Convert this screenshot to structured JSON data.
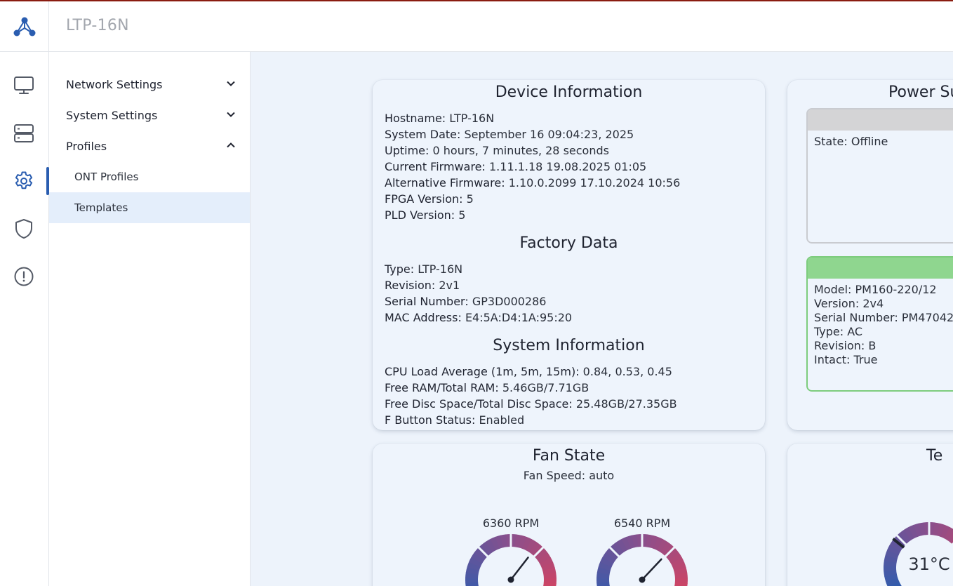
{
  "app": {
    "title": "LTP-16N",
    "logo_icon": "network-logo-icon",
    "accent": "#2a5db0"
  },
  "rail": [
    {
      "icon": "monitor-icon"
    },
    {
      "icon": "server-icon"
    },
    {
      "icon": "gear-icon",
      "active": true
    },
    {
      "icon": "shield-icon"
    },
    {
      "icon": "alert-circle-icon"
    }
  ],
  "sidebar": {
    "groups": [
      {
        "label": "Network Settings",
        "expanded": false
      },
      {
        "label": "System Settings",
        "expanded": false
      },
      {
        "label": "Profiles",
        "expanded": true,
        "items": [
          {
            "label": "ONT Profiles"
          },
          {
            "label": "Templates",
            "active": true
          }
        ]
      }
    ]
  },
  "device_info": {
    "title": "Device Information",
    "rows": [
      {
        "key": "Hostname:",
        "value": "LTP-16N"
      },
      {
        "key": "System Date:",
        "value": "September 16 09:04:23, 2025"
      },
      {
        "key": "Uptime:",
        "value": "0 hours, 7 minutes, 28 seconds"
      },
      {
        "key": "Current Firmware:",
        "value": "1.11.1.18 19.08.2025 01:05"
      },
      {
        "key": "Alternative Firmware:",
        "value": "1.10.0.2099 17.10.2024 10:56"
      },
      {
        "key": "FPGA Version:",
        "value": "5"
      },
      {
        "key": "PLD Version:",
        "value": "5"
      }
    ],
    "factory_title": "Factory Data",
    "factory_rows": [
      {
        "key": "Type:",
        "value": "LTP-16N"
      },
      {
        "key": "Revision:",
        "value": "2v1"
      },
      {
        "key": "Serial Number:",
        "value": "GP3D000286"
      },
      {
        "key": "MAC Address:",
        "value": "E4:5A:D4:1A:95:20"
      }
    ],
    "system_title": "System Information",
    "system_rows": [
      {
        "key": "CPU Load Average (1m, 5m, 15m):",
        "value": "0.84, 0.53, 0.45"
      },
      {
        "key": "Free RAM/Total RAM:",
        "value": "5.46GB/7.71GB"
      },
      {
        "key": "Free Disc Space/Total Disc Space:",
        "value": "25.48GB/27.35GB"
      },
      {
        "key": "F Button Status:",
        "value": "Enabled"
      }
    ]
  },
  "power_supply": {
    "title": "Power Su",
    "unit1": {
      "header_color": "#d4d4d6",
      "border_color": "#c9cbd0",
      "rows": [
        {
          "key": "State:",
          "value": "Offline"
        }
      ]
    },
    "unit2": {
      "header_color": "#8fd68f",
      "border_color": "#7dcc7d",
      "rows": [
        {
          "key": "Model:",
          "value": "PM160-220/12"
        },
        {
          "key": "Version:",
          "value": "2v4"
        },
        {
          "key": "Serial Number:",
          "value": "PM47042"
        },
        {
          "key": "Type:",
          "value": "AC"
        },
        {
          "key": "Revision:",
          "value": "B"
        },
        {
          "key": "Intact:",
          "value": "True"
        }
      ]
    }
  },
  "fan_state": {
    "title": "Fan State",
    "speed_label": "Fan Speed: auto",
    "fans": [
      {
        "label": "6360 RPM",
        "fraction": 0.64
      },
      {
        "label": "6540 RPM",
        "fraction": 0.66
      }
    ]
  },
  "temperature": {
    "title": "Te",
    "value": "31°C",
    "fraction": 0.31
  }
}
